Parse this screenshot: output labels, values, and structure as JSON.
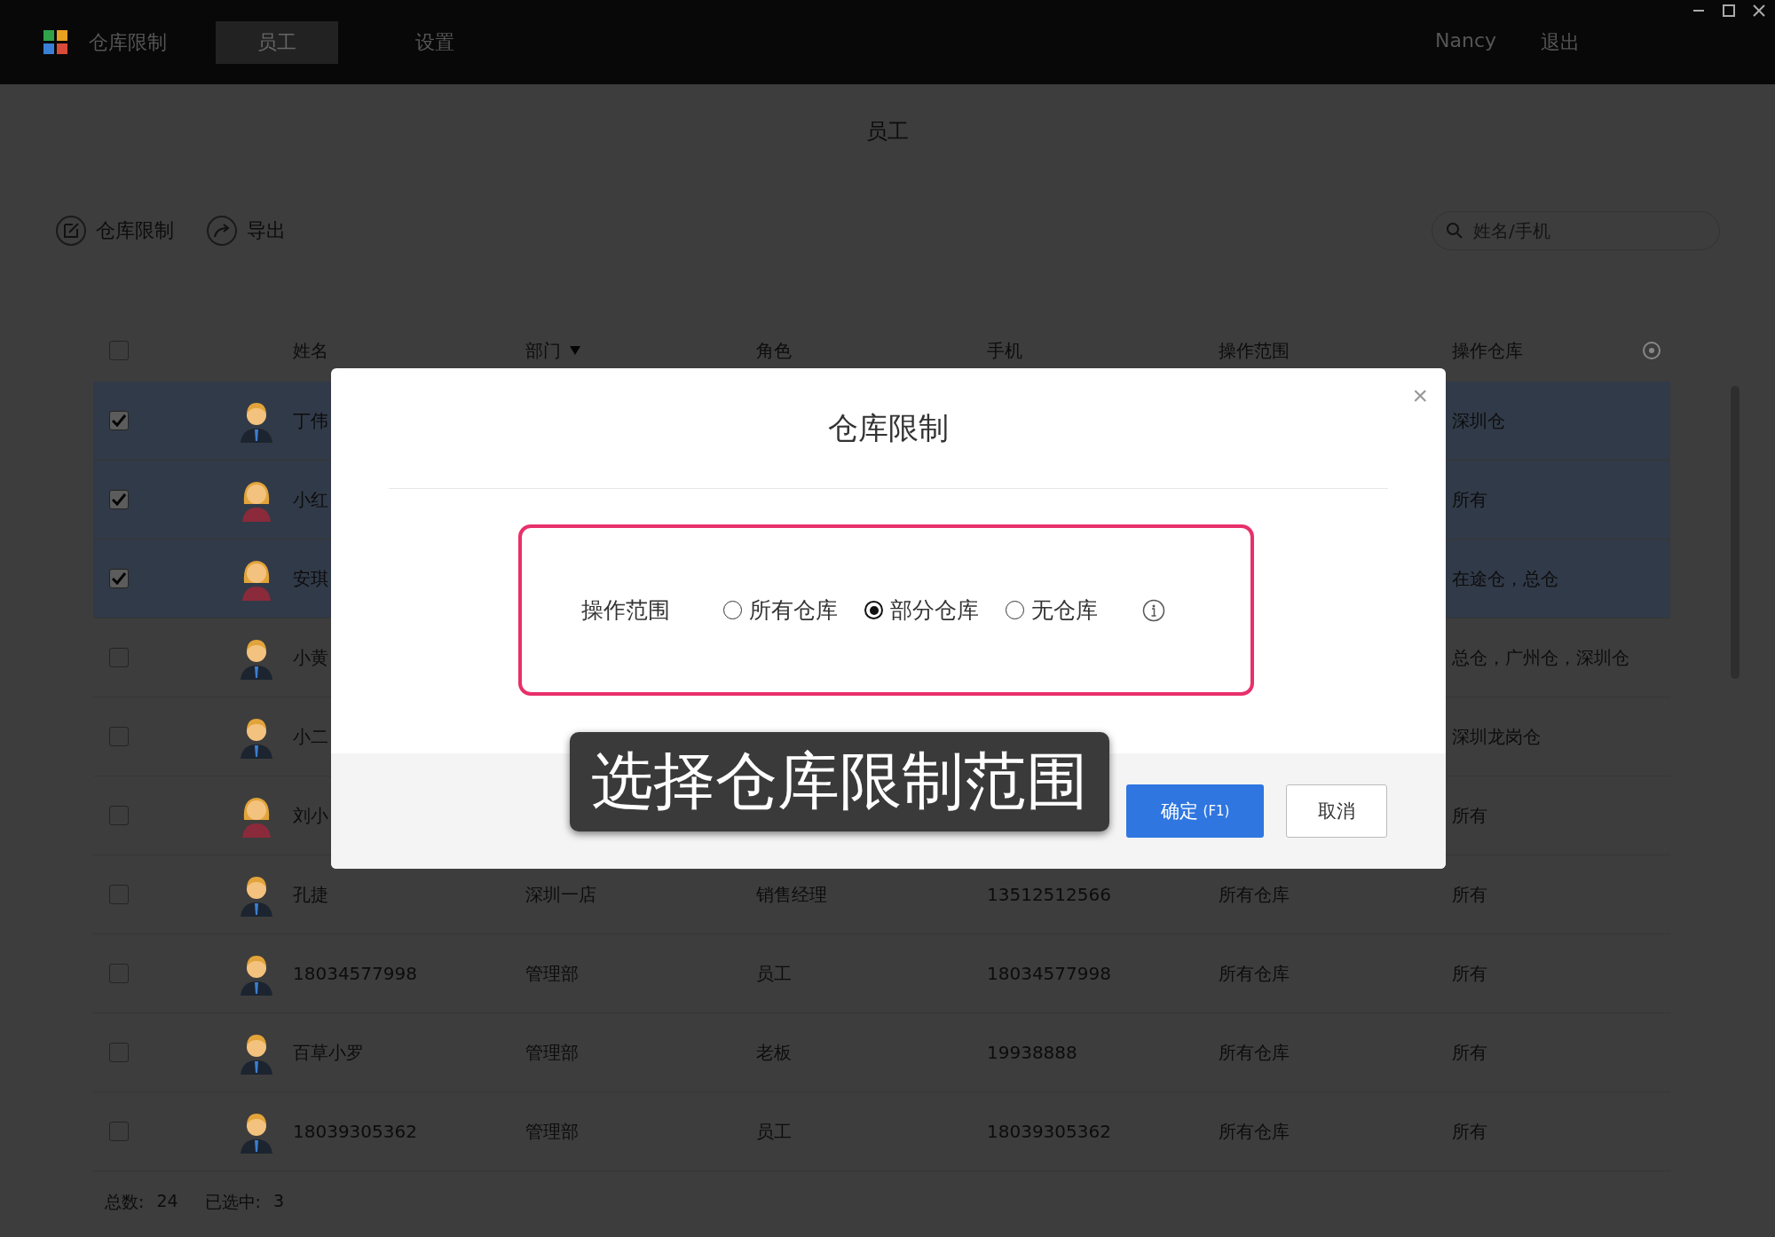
{
  "topbar": {
    "app_name": "仓库限制",
    "tabs": [
      {
        "label": "员工",
        "selected": true
      },
      {
        "label": "设置",
        "selected": false
      }
    ],
    "user": "Nancy",
    "logout": "退出"
  },
  "page_title": "员工",
  "toolbar": {
    "actions": [
      {
        "kind": "edit",
        "label": "仓库限制"
      },
      {
        "kind": "export",
        "label": "导出"
      }
    ],
    "search": {
      "placeholder": "姓名/手机"
    }
  },
  "table": {
    "select_all_checked": false,
    "columns": [
      "姓名",
      "部门",
      "角色",
      "手机",
      "操作范围",
      "操作仓库"
    ],
    "rows": [
      {
        "checked": true,
        "avatar": {
          "kind": "male"
        },
        "name": "丁伟",
        "warehouses": "深圳仓"
      },
      {
        "checked": true,
        "avatar": {
          "kind": "female"
        },
        "name": "小红",
        "warehouses": "所有"
      },
      {
        "checked": true,
        "avatar": {
          "kind": "female"
        },
        "name": "安琪",
        "warehouses": "在途仓，总仓"
      },
      {
        "checked": false,
        "avatar": {
          "kind": "male"
        },
        "name": "小黄",
        "warehouses": "总仓，广州仓，深圳仓"
      },
      {
        "checked": false,
        "avatar": {
          "kind": "male"
        },
        "name": "小二",
        "warehouses": "深圳龙岗仓"
      },
      {
        "checked": false,
        "avatar": {
          "kind": "female"
        },
        "name": "刘小",
        "warehouses": "所有"
      },
      {
        "checked": false,
        "avatar": {
          "kind": "male"
        },
        "name": "孔捷",
        "department": "深圳一店",
        "role": "销售经理",
        "phone": "13512512566",
        "scope": "所有仓库",
        "warehouses": "所有"
      },
      {
        "checked": false,
        "avatar": {
          "kind": "male"
        },
        "name": "18034577998",
        "department": "管理部",
        "role": "员工",
        "phone": "18034577998",
        "scope": "所有仓库",
        "warehouses": "所有"
      },
      {
        "checked": false,
        "avatar": {
          "kind": "male"
        },
        "name": "百草小罗",
        "department": "管理部",
        "role": "老板",
        "phone": "19938888",
        "scope": "所有仓库",
        "warehouses": "所有"
      },
      {
        "checked": false,
        "avatar": {
          "kind": "male"
        },
        "name": "18039305362",
        "department": "管理部",
        "role": "员工",
        "phone": "18039305362",
        "scope": "所有仓库",
        "warehouses": "所有"
      }
    ]
  },
  "footer": {
    "total_label": "总数:",
    "total": "24",
    "selected_label": "已选中:",
    "selected": "3"
  },
  "dialog": {
    "title": "仓库限制",
    "close": "×",
    "scope_label": "操作范围",
    "options": [
      {
        "label": "所有仓库",
        "selected": false
      },
      {
        "label": "部分仓库",
        "selected": true
      },
      {
        "label": "无仓库",
        "selected": false
      }
    ],
    "confirm": "确定",
    "confirm_key": "(F1)",
    "cancel": "取消"
  },
  "caption": "选择仓库限制范围"
}
